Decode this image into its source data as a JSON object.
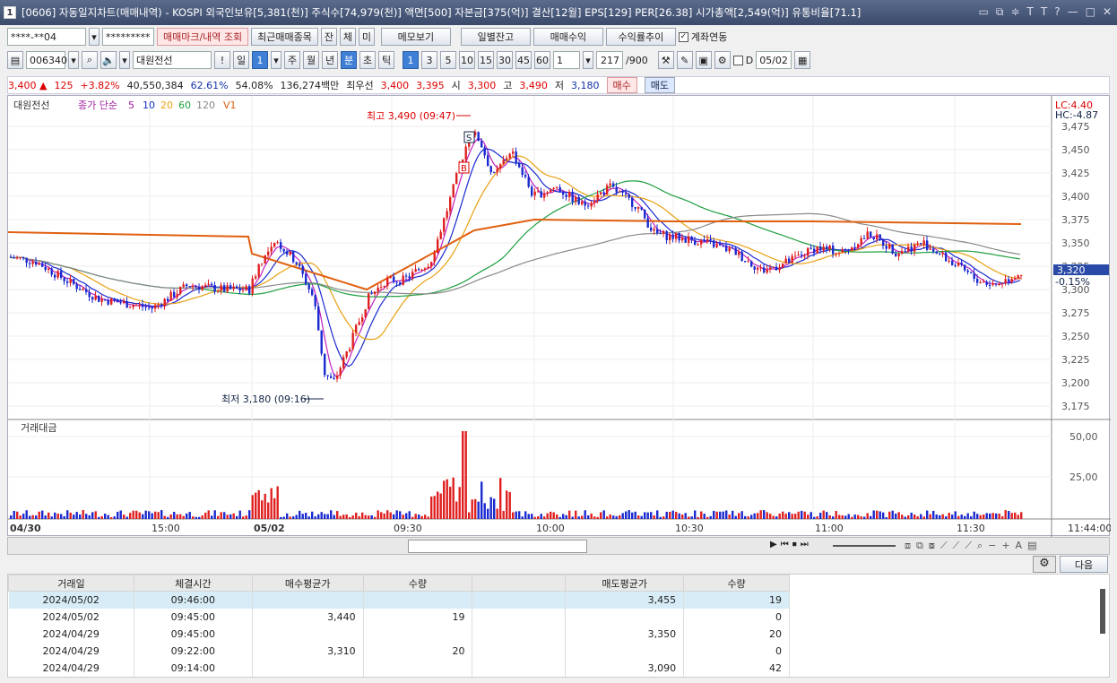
{
  "window": {
    "num": "1",
    "title": "[0606] 자동일지차트(매매내역) - KOSPI 외국인보유[5,381(천)] 주식수[74,979(천)] 액면[500] 자본금[375(억)] 결산[12월] EPS[129] PER[26.38] 시가총액[2,549(억)] 유통비율[71.1]"
  },
  "toolbar1": {
    "account": "****-**04",
    "password": "*********",
    "btn_mark": "매매마크/내역 조회",
    "btn_recent": "최근매매종목",
    "t1": "잔",
    "t2": "체",
    "t3": "미",
    "btn_memo": "메모보기",
    "btn_daily": "일별잔고",
    "btn_profit": "매매수익",
    "btn_rate": "수익률추이",
    "chk_link": "계좌연동"
  },
  "toolbar2": {
    "code": "006340",
    "name": "대원전선",
    "d": "일",
    "d1": "1",
    "w": "주",
    "m": "월",
    "y": "년",
    "min": "분",
    "sec": "초",
    "tick": "틱",
    "m1": "1",
    "m3": "3",
    "m5": "5",
    "m10": "10",
    "m15": "15",
    "m30": "30",
    "m45": "45",
    "m60": "60",
    "unit": "1",
    "count": "217",
    "max": "/900",
    "d_label": "D",
    "date": "05/02"
  },
  "quote": {
    "price": "3,400",
    "change": "125",
    "pct": "+3.82%",
    "volume": "40,550,384",
    "ratio": "62.61%",
    "ratio2": "54.08%",
    "amount": "136,274백만",
    "best": "최우선",
    "ask": "3,400",
    "bid": "3,395",
    "o_l": "시",
    "o": "3,300",
    "h_l": "고",
    "h": "3,490",
    "l_l": "저",
    "l": "3,180",
    "buy": "매수",
    "sell": "매도"
  },
  "chart": {
    "name": "대원전선",
    "legend": "종가 단순",
    "ma": [
      "5",
      "10",
      "20",
      "60",
      "120"
    ],
    "v1": "V1",
    "high_label": "최고 3,490 (09:47)",
    "low_label": "최저 3,180 (09:16)",
    "lc": "LC:4.40",
    "hc": "HC:-4.87",
    "cur": "3,320",
    "cur_pct": "-0.15%",
    "vol_label": "거래대금",
    "vol_ticks": [
      "50,00",
      "25,00"
    ],
    "y_ticks": [
      "3,475",
      "3,450",
      "3,425",
      "3,400",
      "3,375",
      "3,350",
      "3,325",
      "3,300",
      "3,275",
      "3,250",
      "3,225",
      "3,200",
      "3,175"
    ],
    "x_ticks": [
      "04/30",
      "15:00",
      "05/02",
      "09:30",
      "10:00",
      "10:30",
      "11:00",
      "11:30",
      "11:44:00"
    ],
    "colors": {
      "up": "#e02020",
      "down": "#1a2ad0"
    }
  },
  "table": {
    "next": "다음",
    "headers": [
      "거래일",
      "체결시간",
      "매수평균가",
      "수량",
      "",
      "매도평균가",
      "수량"
    ],
    "rows": [
      [
        "2024/05/02",
        "09:46:00",
        "",
        "",
        "",
        "3,455",
        "19"
      ],
      [
        "2024/05/02",
        "09:45:00",
        "3,440",
        "19",
        "",
        "",
        "0"
      ],
      [
        "2024/04/29",
        "09:45:00",
        "",
        "",
        "",
        "3,350",
        "20"
      ],
      [
        "2024/04/29",
        "09:22:00",
        "3,310",
        "20",
        "",
        "",
        "0"
      ],
      [
        "2024/04/29",
        "09:14:00",
        "",
        "",
        "",
        "3,090",
        "42"
      ]
    ]
  }
}
